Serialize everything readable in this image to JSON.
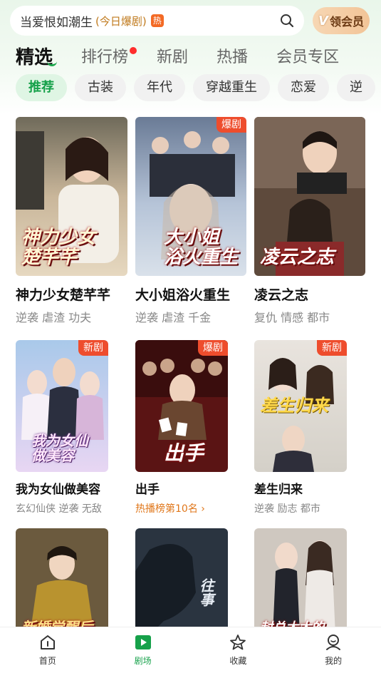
{
  "search": {
    "query": "当爱恨如潮生",
    "suffix": "(今日爆剧)",
    "hot_badge": "热",
    "icon": "search-icon"
  },
  "vip_button": {
    "label": "领会员",
    "mark": "V"
  },
  "tabs": [
    {
      "label": "精选",
      "active": true
    },
    {
      "label": "排行榜",
      "red_dot": true
    },
    {
      "label": "新剧"
    },
    {
      "label": "热播"
    },
    {
      "label": "会员专区"
    }
  ],
  "genres": [
    "推荐",
    "古装",
    "年代",
    "穿越重生",
    "恋爱",
    "逆"
  ],
  "row1": [
    {
      "title": "神力少女楚芊芊",
      "tags": "逆袭 虐渣 功夫",
      "poster_text": "神力少女\n楚芊芊",
      "badge": ""
    },
    {
      "title": "大小姐浴火重生",
      "tags": "逆袭 虐渣 千金",
      "poster_text": "大小姐\n浴火重生",
      "badge": "爆剧"
    },
    {
      "title": "凌云之志",
      "tags": "复仇 情感 都市",
      "poster_text": "凌云之志",
      "badge": ""
    }
  ],
  "row2": [
    {
      "title": "我为女仙做美容",
      "tags": "玄幻仙侠 逆袭 无敌",
      "poster_text": "我为女仙\n做美容",
      "badge": "新剧"
    },
    {
      "title": "出手",
      "rank": "热播榜第10名 ›",
      "poster_text": "出手",
      "badge": "爆剧"
    },
    {
      "title": "差生归来",
      "tags": "逆袭 励志 都市",
      "poster_text": "差生归来",
      "badge": "新剧"
    }
  ],
  "row3": [
    {
      "poster_text": "新婚觉醒后"
    },
    {
      "poster_text": "往事"
    },
    {
      "poster_text": "封总太太的"
    }
  ],
  "bottom_nav": [
    {
      "label": "首页",
      "icon": "home-icon"
    },
    {
      "label": "剧场",
      "icon": "theater-play-icon",
      "active": true
    },
    {
      "label": "收藏",
      "icon": "star-icon"
    },
    {
      "label": "我的",
      "icon": "profile-icon"
    }
  ],
  "colors": {
    "accent": "#16a14a",
    "badge": "#ee4d2d",
    "rank": "#e0771b"
  }
}
